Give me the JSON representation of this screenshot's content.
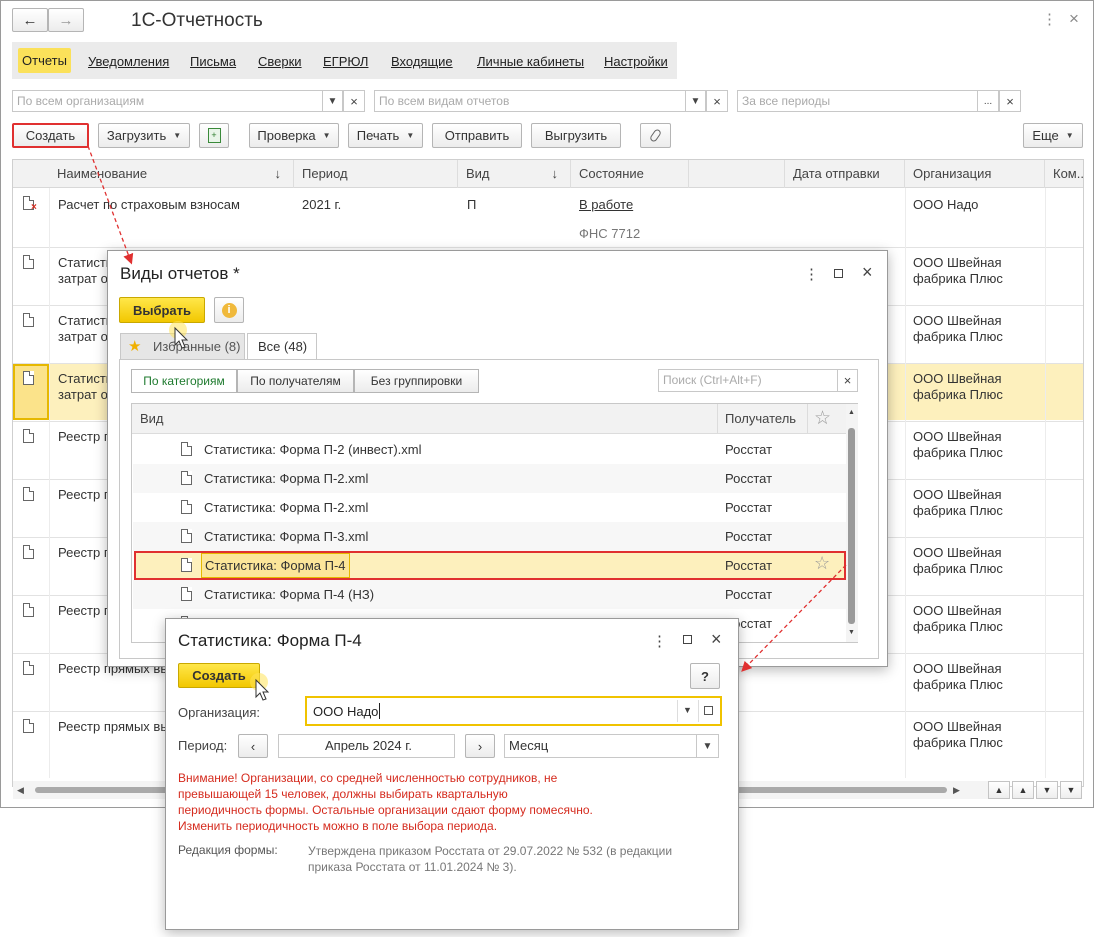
{
  "app": {
    "title": "1С-Отчетность"
  },
  "nav": [
    "Отчеты",
    "Уведомления",
    "Письма",
    "Сверки",
    "ЕГРЮЛ",
    "Входящие",
    "Личные кабинеты",
    "Настройки"
  ],
  "filters": {
    "org": "По всем организациям",
    "kinds": "По всем видам отчетов",
    "periods": "За все периоды"
  },
  "toolbar": {
    "create": "Создать",
    "load": "Загрузить",
    "check": "Проверка",
    "print": "Печать",
    "send": "Отправить",
    "unload": "Выгрузить",
    "more": "Еще"
  },
  "columns": [
    "Наименование",
    "Период",
    "Вид",
    "Состояние",
    "Дата отправки",
    "Организация",
    "Ком..."
  ],
  "rows": [
    {
      "name": "Расчет по страховым взносам",
      "name2": "",
      "period": "2021 г.",
      "kind": "П",
      "state": "В работе",
      "state2": "ФНС 7712",
      "org": "ООО Надо",
      "org2": ""
    },
    {
      "name": "Статисти",
      "name2": "затрат о",
      "org": "ООО Швейная",
      "org2": "фабрика Плюс"
    },
    {
      "name": "Статисти",
      "name2": "затрат о",
      "org": "ООО Швейная",
      "org2": "фабрика Плюс"
    },
    {
      "name": "Статисти",
      "name2": "затрат о",
      "org": "ООО Швейная",
      "org2": "фабрика Плюс"
    },
    {
      "name": "Реестр п",
      "name2": "",
      "org": "ООО Швейная",
      "org2": "фабрика Плюс"
    },
    {
      "name": "Реестр п",
      "name2": "",
      "org": "ООО Швейная",
      "org2": "фабрика Плюс"
    },
    {
      "name": "Реестр п",
      "name2": "",
      "org": "ООО Швейная",
      "org2": "фабрика Плюс"
    },
    {
      "name": "Реестр п",
      "name2": "",
      "org": "ООО Швейная",
      "org2": "фабрика Плюс"
    },
    {
      "name": "Реестр прямых вы",
      "name2": "",
      "org": "ООО Швейная",
      "org2": "фабрика Плюс"
    },
    {
      "name": "Реестр прямых вы",
      "name2": "",
      "org": "ООО Швейная",
      "org2": "фабрика Плюс"
    }
  ],
  "kinds_dialog": {
    "title": "Виды отчетов *",
    "select": "Выбрать",
    "tab_fav": "Избранные (8)",
    "tab_all": "Все (48)",
    "group_cat": "По категориям",
    "group_rec": "По получателям",
    "group_none": "Без группировки",
    "search_placeholder": "Поиск (Ctrl+Alt+F)",
    "col_kind": "Вид",
    "col_recipient": "Получатель",
    "items": [
      {
        "name": "Статистика: Форма П-2 (инвест).xml",
        "recipient": "Росстат"
      },
      {
        "name": "Статистика: Форма П-2.xml",
        "recipient": "Росстат"
      },
      {
        "name": "Статистика: Форма П-2.xml",
        "recipient": "Росстат"
      },
      {
        "name": "Статистика: Форма П-3.xml",
        "recipient": "Росстат"
      },
      {
        "name": "Статистика: Форма П-4",
        "recipient": "Росстат"
      },
      {
        "name": "Статистика: Форма П-4 (НЗ)",
        "recipient": "Росстат"
      },
      {
        "name": "",
        "recipient": "Росстат"
      }
    ]
  },
  "form_dialog": {
    "title": "Статистика: Форма П-4",
    "create": "Создать",
    "help": "?",
    "org_label": "Организация:",
    "org_value": "ООО Надо",
    "period_label": "Период:",
    "period_value": "Апрель 2024  г.",
    "periodicity": "Месяц",
    "warning": [
      "Внимание! Организации, со средней численностью сотрудников, не",
      "превышающей 15 человек, должны выбирать квартальную",
      "периодичность формы. Остальные организации сдают форму помесячно.",
      "Изменить периодичность можно в поле выбора периода."
    ],
    "edition_label": "Редакция формы:",
    "edition_value": [
      "Утверждена приказом Росстата от 29.07.2022 № 532 (в редакции",
      "приказа Росстата от 11.01.2024 № 3)."
    ]
  },
  "colors": {
    "accent_yellow": "#f5d317",
    "highlight_row": "#fdf0bd",
    "red": "#d52b1e",
    "callout": "#e03030"
  }
}
